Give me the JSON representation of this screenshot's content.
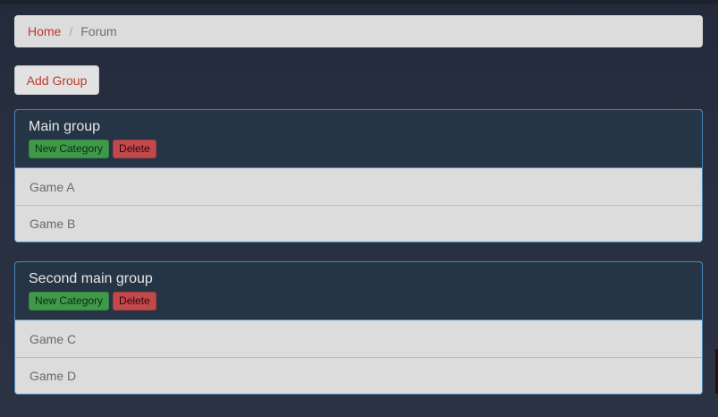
{
  "breadcrumb": {
    "home": "Home",
    "separator": "/",
    "current": "Forum"
  },
  "toolbar": {
    "add_group_label": "Add Group"
  },
  "groups": [
    {
      "title": "Main group",
      "new_category_label": "New Category",
      "delete_label": "Delete",
      "categories": [
        "Game A",
        "Game B"
      ]
    },
    {
      "title": "Second main group",
      "new_category_label": "New Category",
      "delete_label": "Delete",
      "categories": [
        "Game C",
        "Game D"
      ]
    }
  ],
  "colors": {
    "page_background": "#262e3f",
    "link": "#c0392b",
    "panel_border": "#4a86b8",
    "panel_header": "#263546",
    "success": "#3e9a48",
    "danger": "#c1484b"
  }
}
